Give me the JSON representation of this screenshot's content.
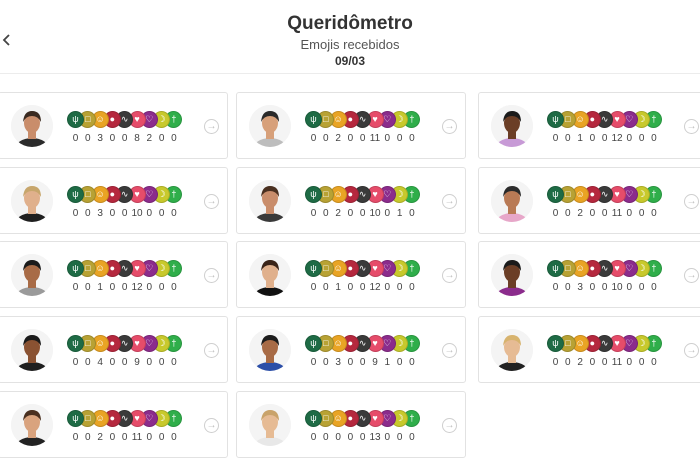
{
  "header": {
    "back_icon": "chevron-left-icon",
    "title": "Queridômetro",
    "subtitle": "Emojis recebidos",
    "date": "09/03"
  },
  "emoji_legend": [
    {
      "name": "plant-icon",
      "color": "#1e6b45"
    },
    {
      "name": "mug-icon",
      "color": "#b8a234"
    },
    {
      "name": "smile-icon",
      "color": "#e9a424"
    },
    {
      "name": "bomb-icon",
      "color": "#b5283e"
    },
    {
      "name": "snake-icon",
      "color": "#3a3a3a"
    },
    {
      "name": "heart-icon",
      "color": "#e64c6a"
    },
    {
      "name": "broken-heart-icon",
      "color": "#8b2c8c"
    },
    {
      "name": "banana-icon",
      "color": "#c8c92c"
    },
    {
      "name": "cactus-icon",
      "color": "#2fae4a"
    }
  ],
  "participants": [
    {
      "counts": [
        "0",
        "0",
        "3",
        "0",
        "0",
        "8",
        "2",
        "0",
        "0"
      ],
      "skin": "#c98d6b",
      "hair": "#3a2a20",
      "shirt": "#2b2b2b"
    },
    {
      "counts": [
        "0",
        "0",
        "2",
        "0",
        "0",
        "11",
        "0",
        "0",
        "0"
      ],
      "skin": "#d7a07a",
      "hair": "#2a2a2a",
      "shirt": "#bdbdbd"
    },
    {
      "counts": [
        "0",
        "0",
        "1",
        "0",
        "0",
        "12",
        "0",
        "0",
        "0"
      ],
      "skin": "#6b3e26",
      "hair": "#1b1b1b",
      "shirt": "#c79ad6"
    },
    {
      "counts": [
        "0",
        "0",
        "3",
        "0",
        "0",
        "10",
        "0",
        "0",
        "0"
      ],
      "skin": "#e0b08c",
      "hair": "#c7a66c",
      "shirt": "#1f1f1f"
    },
    {
      "counts": [
        "0",
        "0",
        "2",
        "0",
        "0",
        "10",
        "0",
        "1",
        "0"
      ],
      "skin": "#c98d6b",
      "hair": "#4a3020",
      "shirt": "#3a3a3a"
    },
    {
      "counts": [
        "0",
        "0",
        "2",
        "0",
        "0",
        "11",
        "0",
        "0",
        "0"
      ],
      "skin": "#b97a55",
      "hair": "#2a2a2a",
      "shirt": "#e7a7c9"
    },
    {
      "counts": [
        "0",
        "0",
        "1",
        "0",
        "0",
        "12",
        "0",
        "0",
        "0"
      ],
      "skin": "#a86b46",
      "hair": "#1b1b1b",
      "shirt": "#9a9a9a"
    },
    {
      "counts": [
        "0",
        "0",
        "1",
        "0",
        "0",
        "12",
        "0",
        "0",
        "0"
      ],
      "skin": "#e0b08c",
      "hair": "#3a2418",
      "shirt": "#111111"
    },
    {
      "counts": [
        "0",
        "0",
        "3",
        "0",
        "0",
        "10",
        "0",
        "0",
        "0"
      ],
      "skin": "#6b3e26",
      "hair": "#1b1b1b",
      "shirt": "#8b2c8c"
    },
    {
      "counts": [
        "0",
        "0",
        "4",
        "0",
        "0",
        "9",
        "0",
        "0",
        "0"
      ],
      "skin": "#8a5232",
      "hair": "#1b1b1b",
      "shirt": "#1f1f1f"
    },
    {
      "counts": [
        "0",
        "0",
        "3",
        "0",
        "0",
        "9",
        "1",
        "0",
        "0"
      ],
      "skin": "#a86b46",
      "hair": "#1b1b1b",
      "shirt": "#2c4fa8"
    },
    {
      "counts": [
        "0",
        "0",
        "2",
        "0",
        "0",
        "11",
        "0",
        "0",
        "0"
      ],
      "skin": "#e6bb94",
      "hair": "#d7b36e",
      "shirt": "#222222"
    },
    {
      "counts": [
        "0",
        "0",
        "2",
        "0",
        "0",
        "11",
        "0",
        "0",
        "0"
      ],
      "skin": "#d9a37e",
      "hair": "#4a3020",
      "shirt": "#222222"
    },
    {
      "counts": [
        "0",
        "0",
        "0",
        "0",
        "0",
        "13",
        "0",
        "0",
        "0"
      ],
      "skin": "#e6bb94",
      "hair": "#c9a36a",
      "shirt": "#e8e8e8"
    }
  ]
}
